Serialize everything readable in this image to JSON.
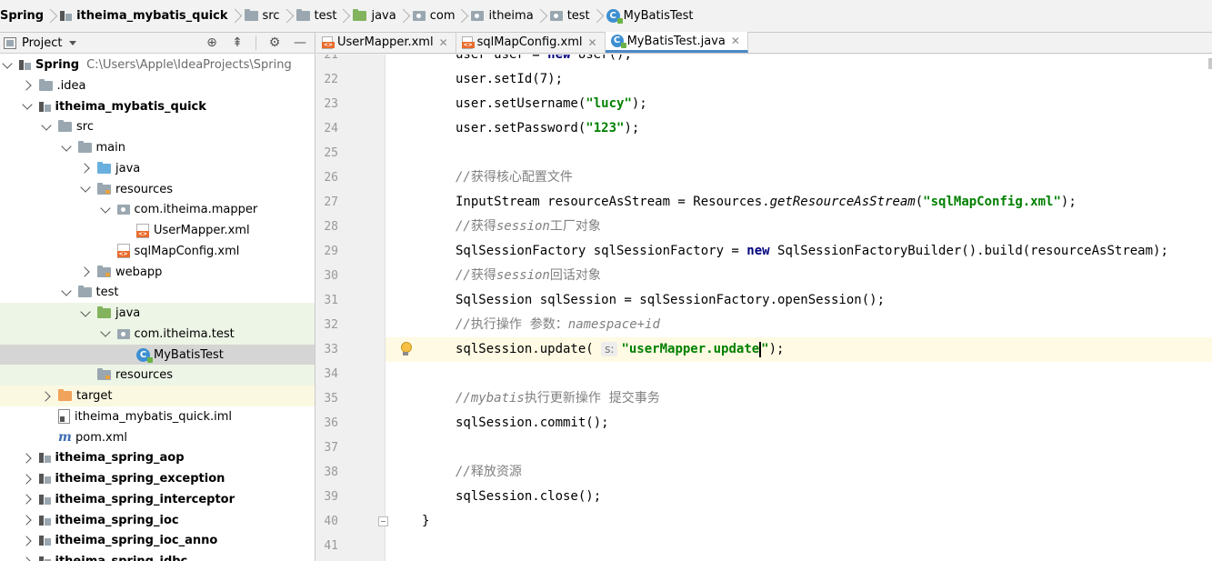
{
  "breadcrumbs": [
    {
      "label": "Spring",
      "icon": "none",
      "bold": true
    },
    {
      "label": "itheima_mybatis_quick",
      "icon": "module-icon",
      "bold": true
    },
    {
      "label": "src",
      "icon": "folder-icon",
      "bold": false
    },
    {
      "label": "test",
      "icon": "folder-icon",
      "bold": false
    },
    {
      "label": "java",
      "icon": "folder-green-icon",
      "bold": false
    },
    {
      "label": "com",
      "icon": "package-icon",
      "bold": false
    },
    {
      "label": "itheima",
      "icon": "package-icon",
      "bold": false
    },
    {
      "label": "test",
      "icon": "package-icon",
      "bold": false
    },
    {
      "label": "MyBatisTest",
      "icon": "class-icon",
      "bold": false
    }
  ],
  "project_panel": {
    "title": "Project",
    "tools": [
      "locate-icon",
      "collapse-all-icon",
      "settings-icon",
      "hide-icon"
    ],
    "tree": [
      {
        "label": "Spring",
        "path": "C:\\Users\\Apple\\IdeaProjects\\Spring",
        "indent": 0,
        "arrow": "down",
        "icon": "module",
        "bold": true,
        "hl": ""
      },
      {
        "label": ".idea",
        "indent": 1,
        "arrow": "right",
        "icon": "folder",
        "bold": false,
        "hl": ""
      },
      {
        "label": "itheima_mybatis_quick",
        "indent": 1,
        "arrow": "down",
        "icon": "module",
        "bold": true,
        "hl": ""
      },
      {
        "label": "src",
        "indent": 2,
        "arrow": "down",
        "icon": "folder",
        "bold": false,
        "hl": ""
      },
      {
        "label": "main",
        "indent": 3,
        "arrow": "down",
        "icon": "folder",
        "bold": false,
        "hl": ""
      },
      {
        "label": "java",
        "indent": 4,
        "arrow": "right",
        "icon": "folder-blue",
        "bold": false,
        "hl": ""
      },
      {
        "label": "resources",
        "indent": 4,
        "arrow": "down",
        "icon": "folder-res",
        "bold": false,
        "hl": ""
      },
      {
        "label": "com.itheima.mapper",
        "indent": 5,
        "arrow": "down",
        "icon": "package",
        "bold": false,
        "hl": ""
      },
      {
        "label": "UserMapper.xml",
        "indent": 6,
        "arrow": "none",
        "icon": "xml",
        "bold": false,
        "hl": ""
      },
      {
        "label": "sqlMapConfig.xml",
        "indent": 5,
        "arrow": "none",
        "icon": "xml",
        "bold": false,
        "hl": ""
      },
      {
        "label": "webapp",
        "indent": 4,
        "arrow": "right",
        "icon": "folder-res",
        "bold": false,
        "hl": ""
      },
      {
        "label": "test",
        "indent": 3,
        "arrow": "down",
        "icon": "folder",
        "bold": false,
        "hl": ""
      },
      {
        "label": "java",
        "indent": 4,
        "arrow": "down",
        "icon": "folder-green",
        "bold": false,
        "hl": "green"
      },
      {
        "label": "com.itheima.test",
        "indent": 5,
        "arrow": "down",
        "icon": "package",
        "bold": false,
        "hl": "green"
      },
      {
        "label": "MyBatisTest",
        "indent": 6,
        "arrow": "none",
        "icon": "class",
        "bold": false,
        "hl": "selected"
      },
      {
        "label": "resources",
        "indent": 4,
        "arrow": "none",
        "icon": "folder-res",
        "bold": false,
        "hl": "green"
      },
      {
        "label": "target",
        "indent": 2,
        "arrow": "right",
        "icon": "folder-orange",
        "bold": false,
        "hl": "yellow"
      },
      {
        "label": "itheima_mybatis_quick.iml",
        "indent": 2,
        "arrow": "none",
        "icon": "iml",
        "bold": false,
        "hl": ""
      },
      {
        "label": "pom.xml",
        "indent": 2,
        "arrow": "none",
        "icon": "maven",
        "bold": false,
        "hl": ""
      },
      {
        "label": "itheima_spring_aop",
        "indent": 1,
        "arrow": "right",
        "icon": "module",
        "bold": true,
        "hl": ""
      },
      {
        "label": "itheima_spring_exception",
        "indent": 1,
        "arrow": "right",
        "icon": "module",
        "bold": true,
        "hl": ""
      },
      {
        "label": "itheima_spring_interceptor",
        "indent": 1,
        "arrow": "right",
        "icon": "module",
        "bold": true,
        "hl": ""
      },
      {
        "label": "itheima_spring_ioc",
        "indent": 1,
        "arrow": "right",
        "icon": "module",
        "bold": true,
        "hl": ""
      },
      {
        "label": "itheima_spring_ioc_anno",
        "indent": 1,
        "arrow": "right",
        "icon": "module",
        "bold": true,
        "hl": ""
      },
      {
        "label": "itheima_spring_jdbc",
        "indent": 1,
        "arrow": "right",
        "icon": "module",
        "bold": true,
        "hl": ""
      }
    ]
  },
  "editor_tabs": [
    {
      "label": "UserMapper.xml",
      "icon": "xml",
      "active": false
    },
    {
      "label": "sqlMapConfig.xml",
      "icon": "xml",
      "active": false
    },
    {
      "label": "MyBatisTest.java",
      "icon": "class",
      "active": true
    }
  ],
  "editor": {
    "current_line": 33,
    "lines": [
      {
        "n": "21",
        "html": "user user = <span class=\"kw\">new</span> User();"
      },
      {
        "n": "22",
        "html": "user.setId(7);"
      },
      {
        "n": "23",
        "html": "user.setUsername(<span class=\"str\">\"lucy\"</span>);"
      },
      {
        "n": "24",
        "html": "user.setPassword(<span class=\"str\">\"123\"</span>);"
      },
      {
        "n": "25",
        "html": ""
      },
      {
        "n": "26",
        "html": "<span class=\"com\">//</span><span class=\"com-cn\">获得核心配置文件</span>"
      },
      {
        "n": "27",
        "html": "InputStream resourceAsStream = Resources.<span class=\"it\">getResourceAsStream</span>(<span class=\"str\">\"sqlMapConfig.xml\"</span>);"
      },
      {
        "n": "28",
        "html": "<span class=\"com\">//</span><span class=\"com-cn\">获得</span><span class=\"com\">session</span><span class=\"com-cn\">工厂对象</span>"
      },
      {
        "n": "29",
        "html": "SqlSessionFactory sqlSessionFactory = <span class=\"kw\">new</span> SqlSessionFactoryBuilder().build(resourceAsStream);"
      },
      {
        "n": "30",
        "html": "<span class=\"com\">//</span><span class=\"com-cn\">获得</span><span class=\"com\">session</span><span class=\"com-cn\">回话对象</span>"
      },
      {
        "n": "31",
        "html": "SqlSession sqlSession = sqlSessionFactory.openSession();"
      },
      {
        "n": "32",
        "html": "<span class=\"com\">//</span><span class=\"com-cn\">执行操作  参数：</span><span class=\"com\">namespace+id</span>"
      },
      {
        "n": "33",
        "html": "sqlSession.update( <span class=\"hint\">s:</span><span class=\"str\">\"userMapper.update</span><span class=\"caret\"></span><span class=\"str\">\"</span>);"
      },
      {
        "n": "34",
        "html": ""
      },
      {
        "n": "35",
        "html": "<span class=\"com\">//mybatis</span><span class=\"com-cn\">执行更新操作  提交事务</span>"
      },
      {
        "n": "36",
        "html": "sqlSession.commit();"
      },
      {
        "n": "37",
        "html": ""
      },
      {
        "n": "38",
        "html": "<span class=\"com\">//</span><span class=\"com-cn\">释放资源</span>"
      },
      {
        "n": "39",
        "html": "sqlSession.close();"
      },
      {
        "n": "40",
        "html": "}"
      },
      {
        "n": "41",
        "html": ""
      }
    ]
  }
}
